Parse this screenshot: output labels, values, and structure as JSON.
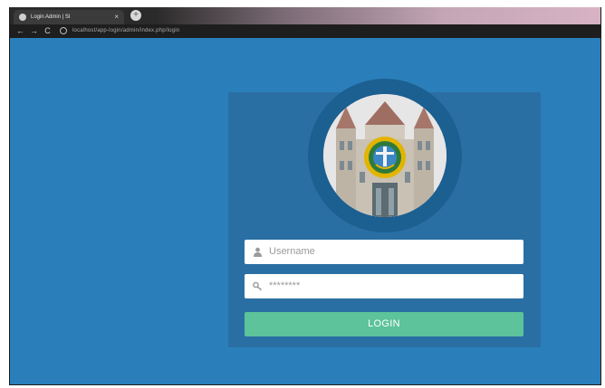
{
  "browser": {
    "tab_title": "Login Admin | SI",
    "tab_close": "×",
    "new_tab": "+",
    "url": "localhost/app-login/admin/index.php/login",
    "nav": {
      "back": "←",
      "forward": "→",
      "reload": "C"
    }
  },
  "login": {
    "username_placeholder": "Username",
    "password_placeholder": "********",
    "button_label": "LOGIN"
  },
  "colors": {
    "page_background": "#2a7fba",
    "panel": "#2a6fa4",
    "logo_ring": "#1c5f91",
    "login_button": "#5cc39b"
  },
  "icons": {
    "username": "user-icon",
    "password": "key-icon"
  }
}
